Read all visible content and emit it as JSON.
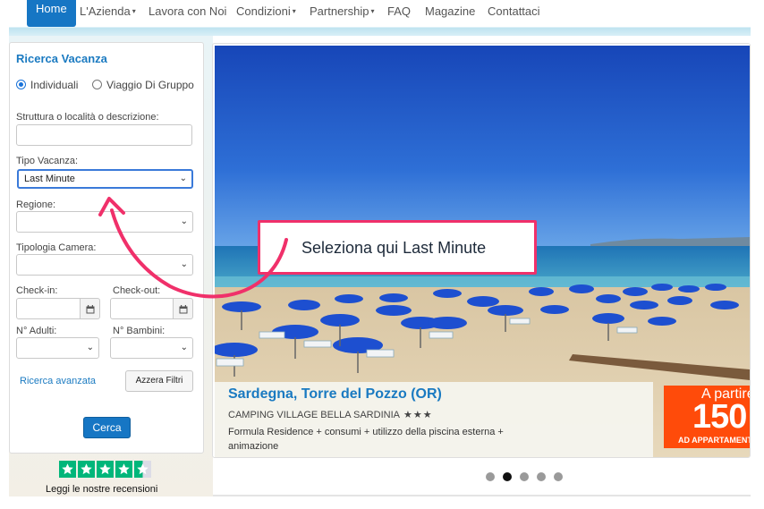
{
  "nav": {
    "items": [
      "Home",
      "L'Azienda",
      "Lavora con Noi",
      "Condizioni",
      "Partnership",
      "FAQ",
      "Magazine",
      "Contattaci"
    ]
  },
  "search": {
    "title": "Ricerca Vacanza",
    "radio_individual": "Individuali",
    "radio_group": "Viaggio Di Gruppo",
    "radio_selected": "Individuali",
    "location_label": "Struttura o località o descrizione:",
    "location_value": "",
    "type_label": "Tipo Vacanza:",
    "type_value": "Last Minute",
    "region_label": "Regione:",
    "region_value": "",
    "room_label": "Tipologia Camera:",
    "room_value": "",
    "checkin_label": "Check-in:",
    "checkout_label": "Check-out:",
    "adults_label": "N° Adulti:",
    "children_label": "N° Bambini:",
    "advanced_link": "Ricerca avanzata",
    "reset_button": "Azzera Filtri",
    "search_button": "Cerca"
  },
  "reviews": {
    "text": "Leggi le nostre recensioni",
    "rating": 4.5
  },
  "slide": {
    "title": "Sardegna, Torre del Pozzo (OR)",
    "subtitle": "CAMPING VILLAGE BELLA SARDINIA",
    "stars": "★★★",
    "description": "Formula Residence + consumi + utilizzo della piscina esterna + animazione",
    "price_label": "A partire",
    "price_value": "150",
    "price_unit": "AD APPARTAMENTO",
    "active_dot": 2,
    "dot_count": 5
  },
  "callout": {
    "text": "Seleziona qui Last Minute"
  },
  "colors": {
    "brand_blue": "#1676c4",
    "link_blue": "#1a7ac1",
    "callout_pink": "#f0306a",
    "price_orange": "#ff4b0a"
  }
}
